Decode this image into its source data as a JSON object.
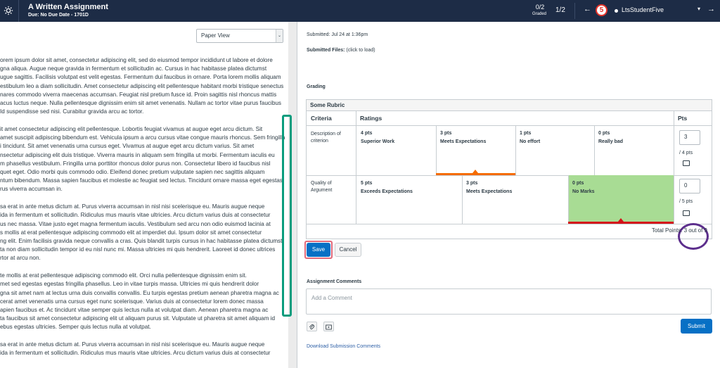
{
  "header": {
    "title": "A Written Assignment",
    "due": "Due: No Due Date - 1701D",
    "graded_count": "0/2",
    "graded_label": "Graded",
    "pager": "1/2",
    "prev_arrow": "←",
    "next_arrow": "→",
    "badge": "5",
    "student": "LtsStudentFive",
    "caret": "▾"
  },
  "left": {
    "view_select": "Paper View",
    "paragraphs": [
      [
        "orem ipsum dolor sit amet, consectetur adipiscing elit, sed do eiusmod tempor incididunt ut labore et dolore",
        "gna aliqua. Augue neque gravida in fermentum et sollicitudin ac. Cursus in hac habitasse platea dictumst",
        "ugue sagittis. Facilisis volutpat est velit egestas. Fermentum dui faucibus in ornare. Porta lorem mollis aliquam",
        "estibulum leo a diam sollicitudin. Amet consectetur adipiscing elit pellentesque habitant morbi tristique senectus",
        "nares commodo viverra maecenas accumsan. Feugiat nisl pretium fusce id. Proin sagittis nisl rhoncus mattis",
        "acus luctus neque. Nulla pellentesque dignissim enim sit amet venenatis. Nullam ac tortor vitae purus faucibus",
        "Id suspendisse sed nisi. Curabitur gravida arcu ac tortor."
      ],
      [
        "it amet consectetur adipiscing elit pellentesque. Lobortis feugiat vivamus at augue eget arcu dictum. Sit",
        "amet suscipit adipiscing bibendum est. Vehicula ipsum a arcu cursus vitae congue mauris rhoncus. Sem fringilla",
        "i tincidunt. Sit amet venenatis urna cursus eget. Vivamus at augue eget arcu dictum varius. Sit amet",
        "nsectetur adipiscing elit duis tristique. Viverra mauris in aliquam sem fringilla ut morbi. Fermentum iaculis eu",
        "m phasellus vestibulum. Fringilla urna porttitor rhoncus dolor purus non. Consectetur libero id faucibus nisl",
        "quet eget. Odio morbi quis commodo odio. Eleifend donec pretium vulputate sapien nec sagittis aliquam",
        "ntum bibendum. Massa sapien faucibus et molestie ac feugiat sed lectus. Tincidunt ornare massa eget egestas",
        "rus viverra accumsan in."
      ],
      [
        "sa erat in ante metus dictum at. Purus viverra accumsan in nisl nisi scelerisque eu. Mauris augue neque",
        "ida in fermentum et sollicitudin. Ridiculus mus mauris vitae ultricies. Arcu dictum varius duis at consectetur",
        "us nec massa. Vitae justo eget magna fermentum iaculis. Vestibulum sed arcu non odio euismod lacinia at",
        "s mollis at erat pellentesque adipiscing commodo elit at imperdiet dui. Ipsum dolor sit amet consectetur",
        "ng elit. Enim facilisis gravida neque convallis a cras. Quis blandit turpis cursus in hac habitasse platea dictumst",
        "ta non diam sollicitudin tempor id eu nisl nunc mi. Massa ultricies mi quis hendrerit. Laoreet id donec ultrices",
        "rtor at arcu non."
      ],
      [
        "te mollis at erat pellentesque adipiscing commodo elit. Orci nulla pellentesque dignissim enim sit.",
        "met sed egestas egestas fringilla phasellus. Leo in vitae turpis massa. Ultricies mi quis hendrerit dolor",
        "gna sit amet nam at lectus urna duis convallis convallis. Eu turpis egestas pretium aenean pharetra magna ac",
        "cerat amet venenatis urna cursus eget nunc scelerisque. Varius duis at consectetur lorem donec massa",
        "apien faucibus et. Ac tincidunt vitae semper quis lectus nulla at volutpat diam. Aenean pharetra magna ac",
        "ta faucibus sit amet consectetur adipiscing elit ut aliquam purus sit. Vulputate ut pharetra sit amet aliquam id",
        "ebus egestas ultricies. Semper quis lectus nulla at volutpat."
      ],
      [
        "sa erat in ante metus dictum at. Purus viverra accumsan in nisl nisi scelerisque eu. Mauris augue neque",
        "ida in fermentum et sollicitudin. Ridiculus mus mauris vitae ultricies. Arcu dictum varius duis at consectetur"
      ]
    ]
  },
  "right": {
    "submitted": "Submitted: Jul 24 at 1:36pm",
    "files_label": "Submitted Files:",
    "files_hint": "(click to load)",
    "grading": "Grading",
    "rubric": {
      "title": "Some Rubric",
      "col_criteria": "Criteria",
      "col_ratings": "Ratings",
      "col_pts": "Pts",
      "rows": [
        {
          "criterion": "Description of criterion",
          "ratings": [
            {
              "pts": "4 pts",
              "label": "Superior Work"
            },
            {
              "pts": "3 pts",
              "label": "Meets Expectations"
            },
            {
              "pts": "1 pts",
              "label": "No effort"
            },
            {
              "pts": "0 pts",
              "label": "Really bad"
            }
          ],
          "score": "3",
          "out_of": "/ 4 pts",
          "selected_index": 1
        },
        {
          "criterion": "Quality of Argument",
          "ratings": [
            {
              "pts": "5 pts",
              "label": "Exceeds Expectations"
            },
            {
              "pts": "3 pts",
              "label": "Meets Expectations"
            },
            {
              "pts": "0 pts",
              "label": "No Marks"
            }
          ],
          "score": "0",
          "out_of": "/ 5 pts",
          "selected_index": 2
        }
      ],
      "total": "Total Points: 3 out of 9"
    },
    "save": "Save",
    "cancel": "Cancel",
    "comments_label": "Assignment Comments",
    "comment_placeholder": "Add a Comment",
    "submit": "Submit",
    "download": "Download Submission Comments"
  },
  "colors": {
    "header_bg": "#1d2c46",
    "save_bg": "#0770c5",
    "selected_green": "#a8dc94",
    "selected_orange": "#f56c00",
    "badge_red": "#e4332a",
    "highlight_teal": "#0a9c7d",
    "highlight_purple": "#5c2e8c"
  },
  "icons": [
    "gear-icon",
    "arrow-left-icon",
    "arrow-right-icon",
    "caret-down-icon",
    "comment-bubble-icon",
    "paperclip-icon",
    "media-icon"
  ]
}
